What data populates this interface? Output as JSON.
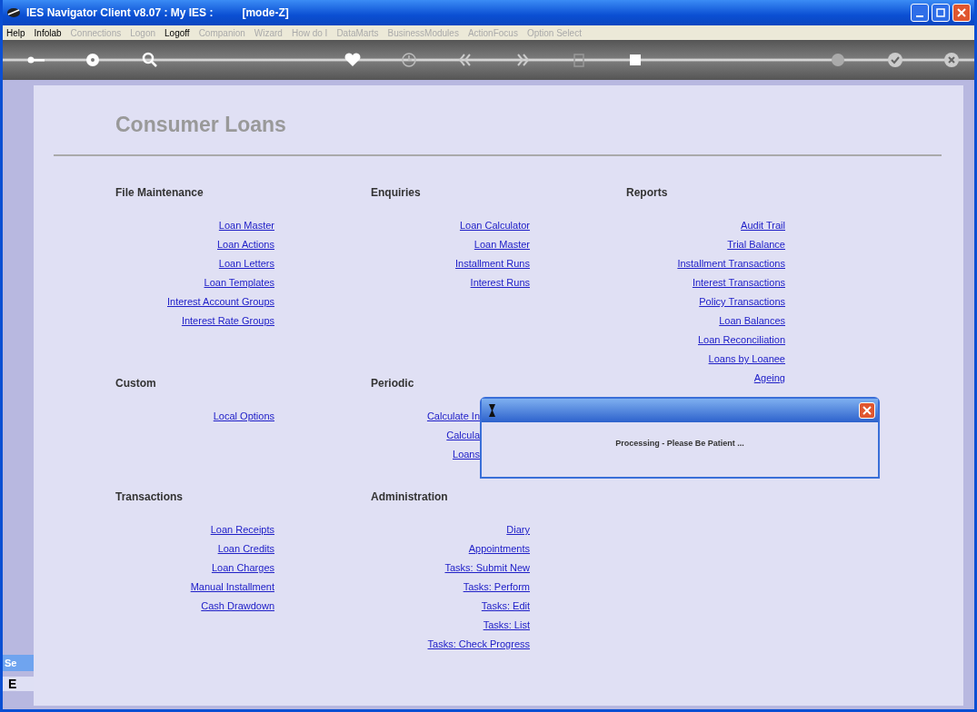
{
  "window": {
    "title": "IES Navigator Client v8.07 : My IES :",
    "mode": "[mode-Z]"
  },
  "menu": [
    {
      "label": "Help",
      "disabled": false
    },
    {
      "label": "Infolab",
      "disabled": false
    },
    {
      "label": "Connections",
      "disabled": true
    },
    {
      "label": "Logon",
      "disabled": true
    },
    {
      "label": "Logoff",
      "disabled": false
    },
    {
      "label": "Companion",
      "disabled": true
    },
    {
      "label": "Wizard",
      "disabled": true
    },
    {
      "label": "How do I",
      "disabled": true
    },
    {
      "label": "DataMarts",
      "disabled": true
    },
    {
      "label": "BusinessModules",
      "disabled": true
    },
    {
      "label": "ActionFocus",
      "disabled": true
    },
    {
      "label": "Option Select",
      "disabled": true
    }
  ],
  "page_title": "Consumer Loans",
  "columns": [
    {
      "sections": [
        {
          "heading": "File Maintenance",
          "links": [
            "Loan Master",
            "Loan Actions",
            "Loan Letters",
            "Loan Templates",
            "Interest Account Groups",
            "Interest Rate Groups"
          ]
        },
        {
          "heading": "Custom",
          "links": [
            "Local Options"
          ]
        },
        {
          "heading": "Transactions",
          "links": [
            "Loan Receipts",
            "Loan Credits",
            "Loan Charges",
            "Manual Installment",
            "Cash Drawdown"
          ]
        }
      ]
    },
    {
      "sections": [
        {
          "heading": "Enquiries",
          "links": [
            "Loan Calculator",
            "Loan Master",
            "Installment Runs",
            "Interest Runs"
          ]
        },
        {
          "heading": "Periodic",
          "links": [
            "Calculate In",
            "Calcula",
            "Loans"
          ]
        },
        {
          "heading": "Administration",
          "links": [
            "Diary",
            "Appointments",
            "Tasks: Submit New",
            "Tasks: Perform",
            "Tasks: Edit",
            "Tasks: List",
            "Tasks: Check Progress"
          ]
        }
      ]
    },
    {
      "sections": [
        {
          "heading": "Reports",
          "links": [
            "Audit Trail",
            "Trial Balance",
            "Installment Transactions",
            "Interest Transactions",
            "Policy Transactions",
            "Loan Balances",
            "Loan Reconciliation",
            "Loans by Loanee",
            "Ageing"
          ]
        }
      ]
    }
  ],
  "dialog": {
    "message": "Processing - Please Be Patient ..."
  },
  "side_panel": {
    "title": "Se",
    "item": "E"
  }
}
